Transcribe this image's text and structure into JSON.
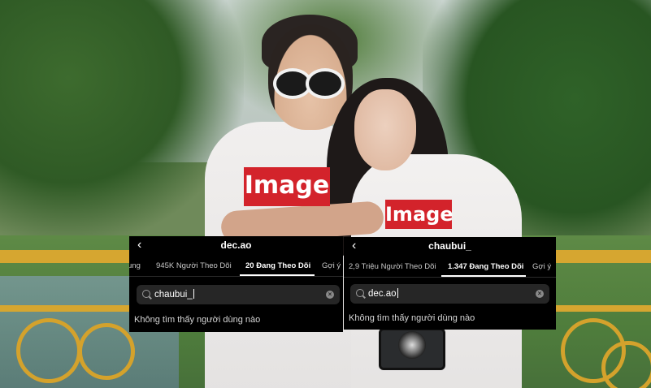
{
  "panels": [
    {
      "username": "dec.ao",
      "tabs": [
        {
          "label": "ung",
          "active": false
        },
        {
          "label": "945K Người Theo Dõi",
          "active": false
        },
        {
          "label": "20 Đang Theo Dõi",
          "active": true
        },
        {
          "label": "Gợi ý",
          "active": false
        }
      ],
      "search_value": "chaubui_",
      "empty_message": "Không tìm thấy người dùng nào"
    },
    {
      "username": "chaubui_",
      "tabs": [
        {
          "label": "2,9 Triệu Người Theo Dõi",
          "active": false
        },
        {
          "label": "1.347 Đang Theo Dõi",
          "active": true
        },
        {
          "label": "Gợi ý",
          "active": false
        }
      ],
      "search_value": "dec.ao",
      "empty_message": "Không tìm thấy người dùng nào"
    }
  ],
  "photo": {
    "shirt_logo_text": "Image"
  },
  "colors": {
    "panel_bg": "#000000",
    "search_bg": "#262626",
    "railing": "#d6a630",
    "logo_red": "#d3232b"
  },
  "icons": {
    "back": "chevron-left-icon",
    "search": "search-icon",
    "clear": "clear-icon"
  }
}
